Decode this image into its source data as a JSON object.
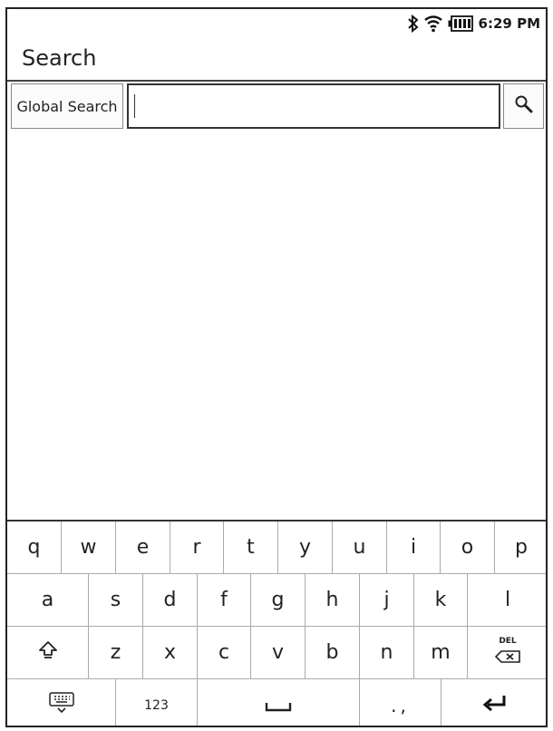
{
  "status_bar": {
    "icons": [
      "bluetooth-icon",
      "wifi-icon",
      "battery-icon"
    ],
    "time": "6:29 PM"
  },
  "header": {
    "title": "Search"
  },
  "search": {
    "scope_label": "Global Search",
    "query": "",
    "search_icon": "search-icon"
  },
  "keyboard": {
    "row1": [
      "q",
      "w",
      "e",
      "r",
      "t",
      "y",
      "u",
      "i",
      "o",
      "p"
    ],
    "row2": [
      "a",
      "s",
      "d",
      "f",
      "g",
      "h",
      "j",
      "k",
      "l"
    ],
    "row3": [
      "z",
      "x",
      "c",
      "v",
      "b",
      "n",
      "m"
    ],
    "shift_icon": "shift-icon",
    "del_label": "DEL",
    "keyboard_toggle_icon": "keyboard-hide-icon",
    "numbers_label": "123",
    "space_icon": "space-icon",
    "punct_label": ".,",
    "enter_icon": "enter-icon"
  }
}
